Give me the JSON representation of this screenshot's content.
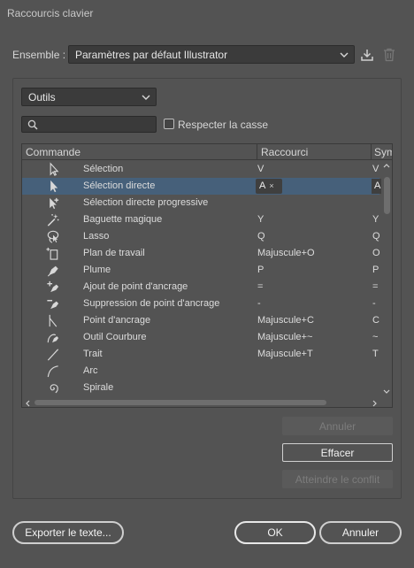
{
  "window": {
    "title": "Raccourcis clavier"
  },
  "ensemble": {
    "label": "Ensemble :",
    "value": "Paramètres par défaut Illustrator"
  },
  "category": {
    "value": "Outils"
  },
  "search": {
    "placeholder": ""
  },
  "case_checkbox": {
    "label": "Respecter la casse",
    "checked": false
  },
  "table": {
    "headers": {
      "command": "Commande",
      "shortcut": "Raccourci",
      "symbol": "Sym"
    },
    "rows": [
      {
        "icon": "selection-arrow-icon",
        "command": "Sélection",
        "shortcut": "V",
        "symbol": "V"
      },
      {
        "icon": "direct-selection-icon",
        "command": "Sélection directe",
        "shortcut": "A",
        "symbol": "A",
        "selected": true
      },
      {
        "icon": "group-selection-icon",
        "command": "Sélection directe progressive",
        "shortcut": "",
        "symbol": ""
      },
      {
        "icon": "magic-wand-icon",
        "command": "Baguette magique",
        "shortcut": "Y",
        "symbol": "Y"
      },
      {
        "icon": "lasso-icon",
        "command": "Lasso",
        "shortcut": "Q",
        "symbol": "Q"
      },
      {
        "icon": "artboard-icon",
        "command": "Plan de travail",
        "shortcut": "Majuscule+O",
        "symbol": "O"
      },
      {
        "icon": "pen-icon",
        "command": "Plume",
        "shortcut": "P",
        "symbol": "P"
      },
      {
        "icon": "add-anchor-point-icon",
        "command": "Ajout de point d'ancrage",
        "shortcut": "=",
        "symbol": "="
      },
      {
        "icon": "delete-anchor-point-icon",
        "command": "Suppression de point d'ancrage",
        "shortcut": "-",
        "symbol": "-"
      },
      {
        "icon": "anchor-point-icon",
        "command": "Point d'ancrage",
        "shortcut": "Majuscule+C",
        "symbol": "C"
      },
      {
        "icon": "curvature-icon",
        "command": "Outil Courbure",
        "shortcut": "Majuscule+~",
        "symbol": "~"
      },
      {
        "icon": "line-segment-icon",
        "command": "Trait",
        "shortcut": "Majuscule+T",
        "symbol": "T"
      },
      {
        "icon": "arc-icon",
        "command": "Arc",
        "shortcut": "",
        "symbol": ""
      },
      {
        "icon": "spiral-icon",
        "command": "Spirale",
        "shortcut": "",
        "symbol": ""
      }
    ],
    "clear_glyph": "×"
  },
  "buttons": {
    "annuler_side": "Annuler",
    "effacer": "Effacer",
    "atteindre": "Atteindre le conflit",
    "export": "Exporter le texte...",
    "ok": "OK",
    "cancel": "Annuler"
  }
}
